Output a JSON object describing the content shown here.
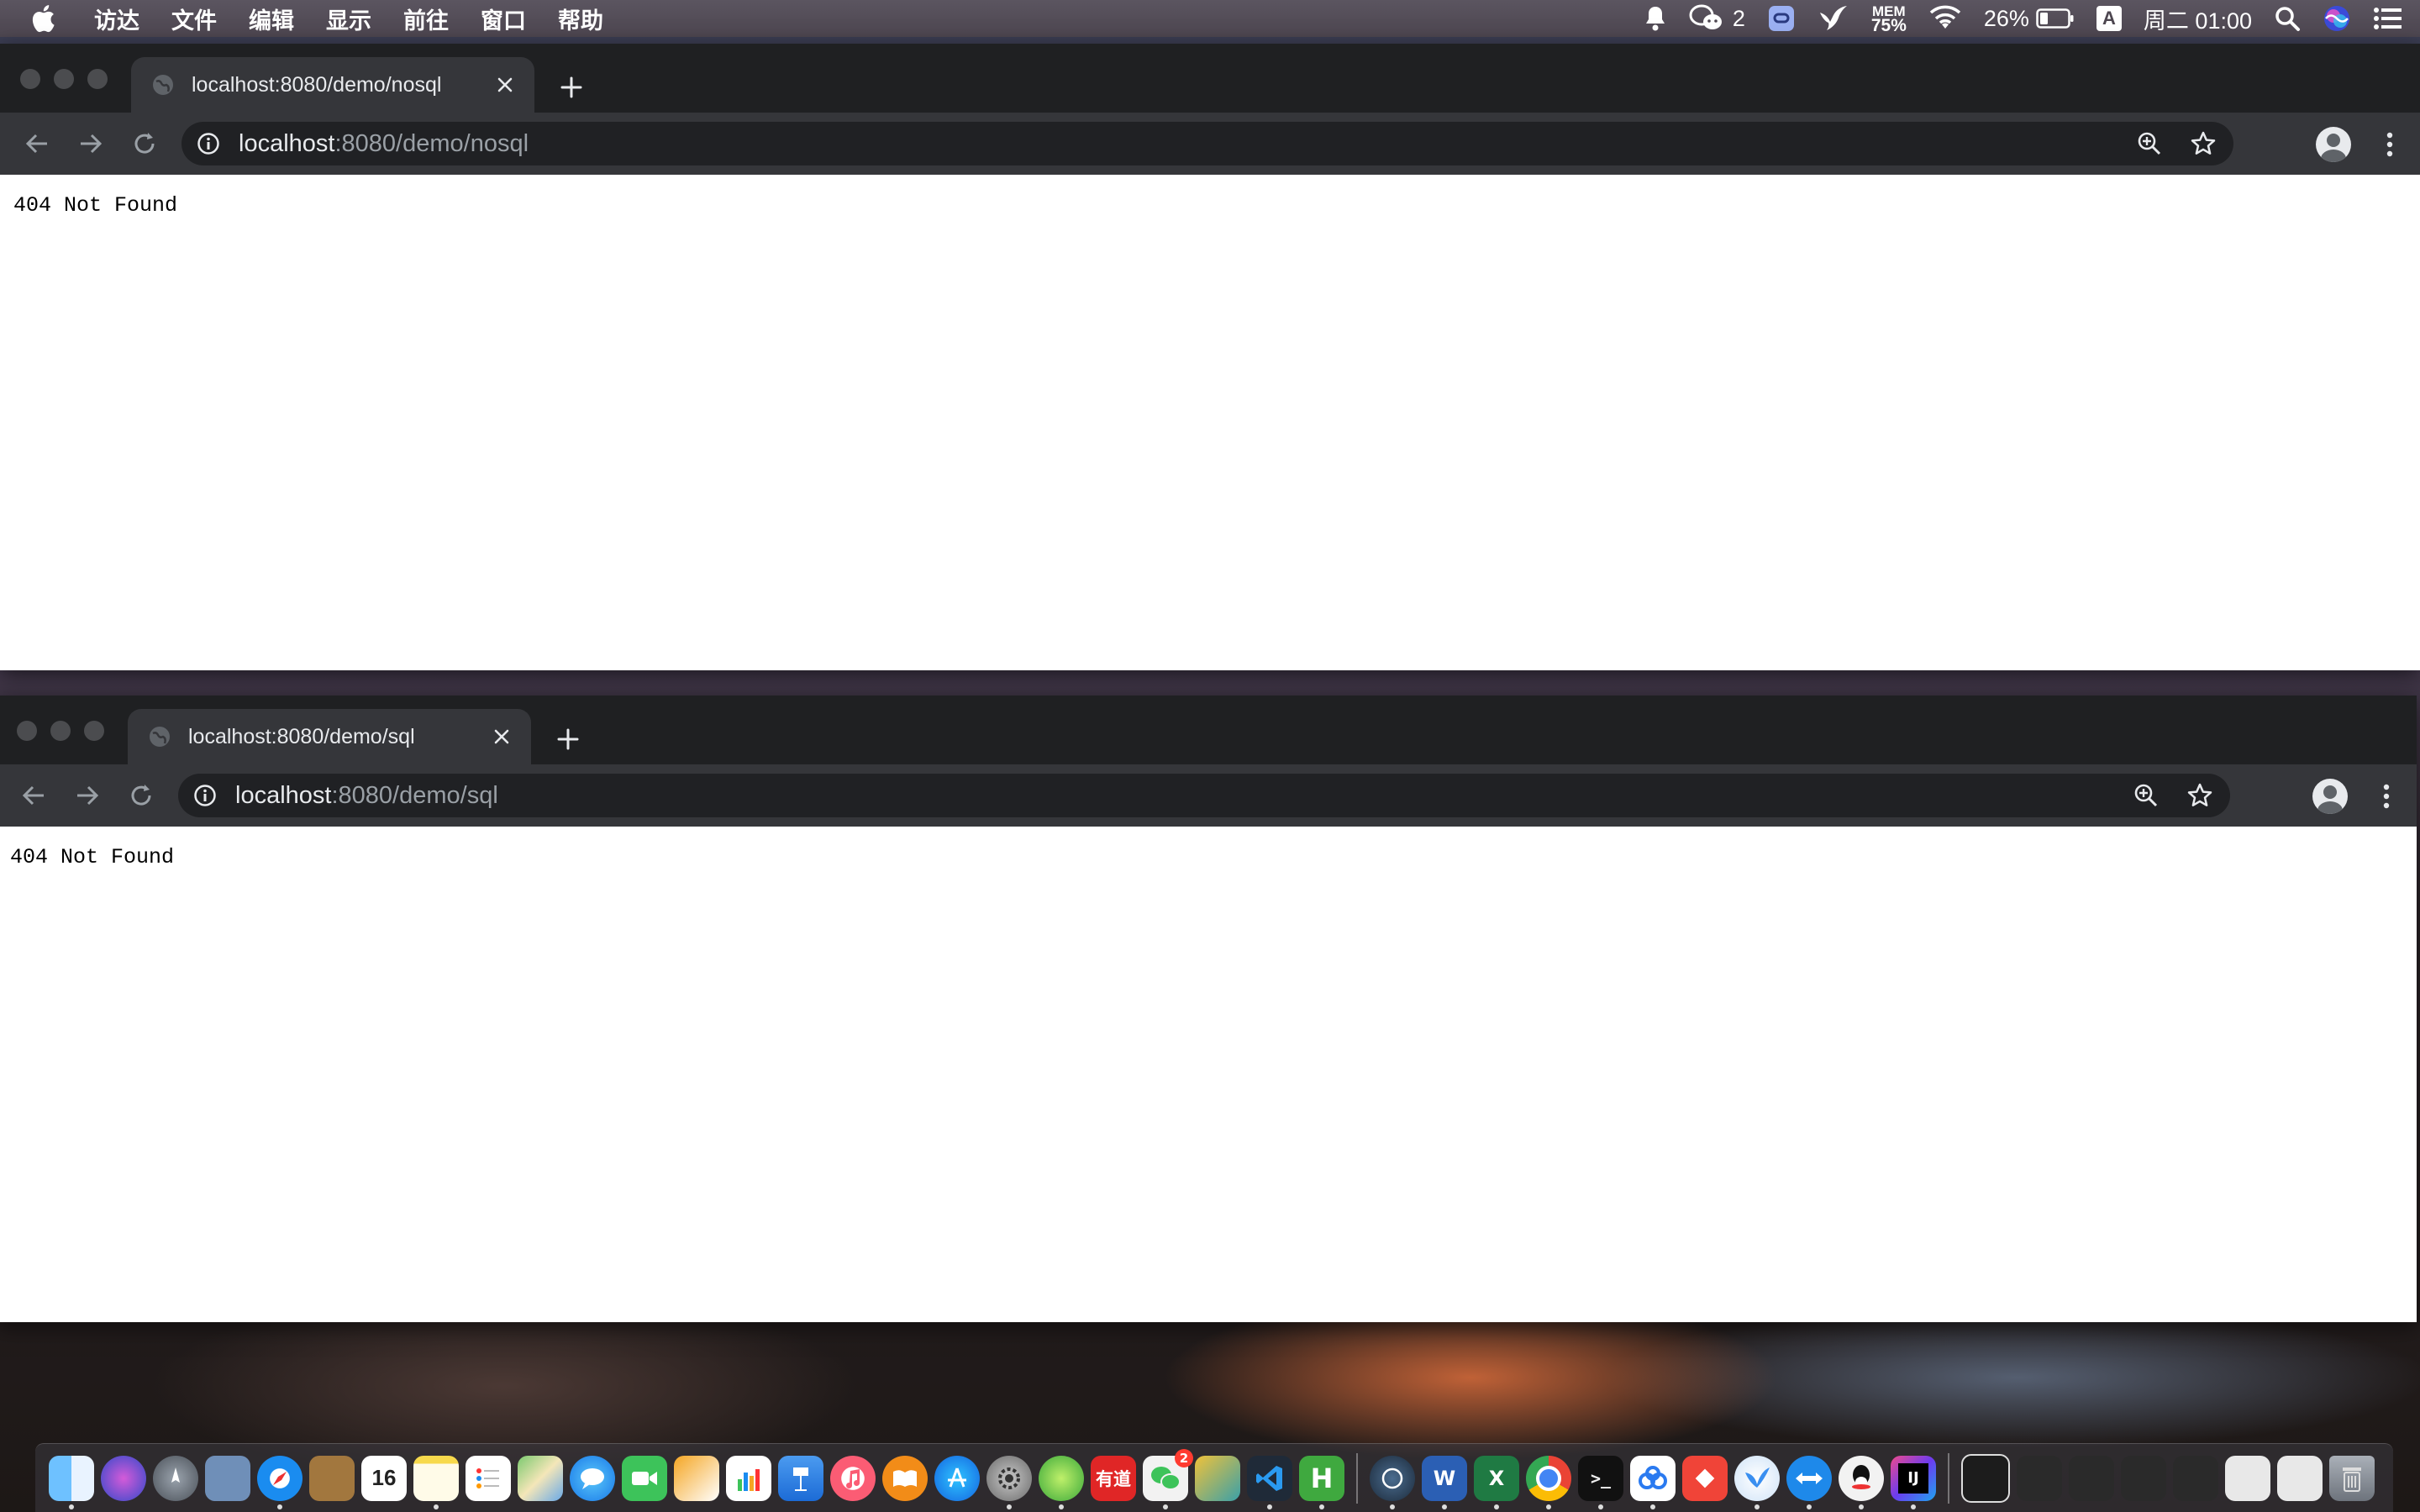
{
  "menubar": {
    "items": [
      "访达",
      "文件",
      "编辑",
      "显示",
      "前往",
      "窗口",
      "帮助"
    ],
    "wechat_count": "2",
    "mem_label": "MEM",
    "mem_value": "75%",
    "battery": "26%",
    "input_method": "A",
    "clock": "周二 01:00"
  },
  "windows": [
    {
      "tab_title": "localhost:8080/demo/nosql",
      "url_host": "localhost",
      "url_path": ":8080/demo/nosql",
      "body_text": "404 Not Found"
    },
    {
      "tab_title": "localhost:8080/demo/sql",
      "url_host": "localhost",
      "url_path": ":8080/demo/sql",
      "body_text": "404 Not Found"
    }
  ],
  "dock": {
    "calendar_day": "16",
    "wechat_badge": "2",
    "youdao_label": "有道",
    "word_label": "W",
    "excel_label": "X",
    "hbuilder_label": "H",
    "intellij_label": "IJ"
  },
  "colors": {
    "chrome_frame": "#1f2022",
    "chrome_toolbar": "#35363a",
    "omnibox": "#202124",
    "text_light": "#e8eaed",
    "text_dim": "#9aa0a6"
  }
}
